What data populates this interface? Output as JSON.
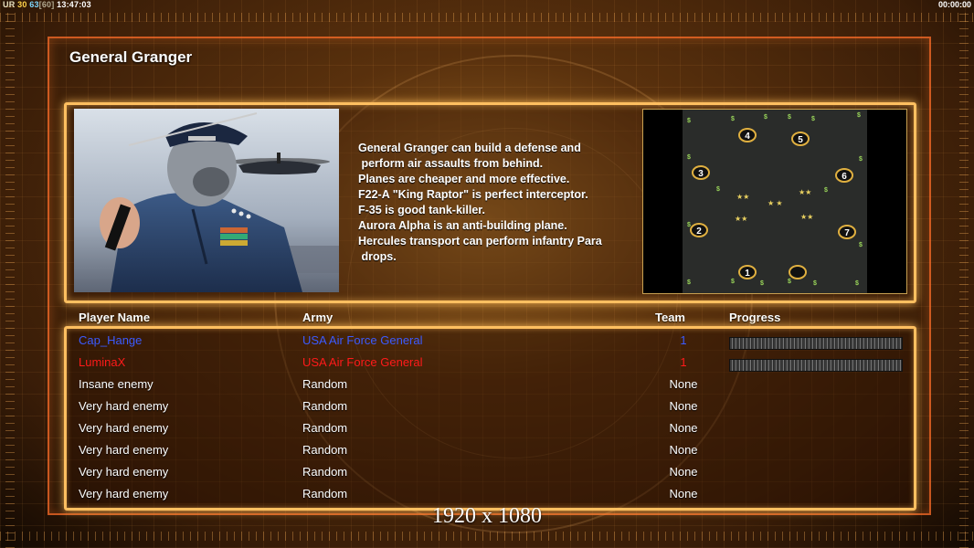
{
  "status_bar": {
    "ur_label": "UR",
    "fps_a": "30",
    "fps_b": "63",
    "fps_c": "[60]",
    "clock": "13:47:03",
    "timer": "00:00:00"
  },
  "title": "General Granger",
  "description_lines": [
    "General Granger can build a defense and",
    " perform air assaults from behind.",
    "Planes are cheaper and more effective.",
    "F22-A \"King Raptor\" is perfect interceptor.",
    "F-35 is good tank-killer.",
    "Aurora Alpha is an anti-building plane.",
    "Hercules transport can perform infantry Para",
    " drops."
  ],
  "minimap": {
    "start_positions": [
      "1",
      "2",
      "3",
      "4",
      "5",
      "6",
      "7",
      ""
    ],
    "resource_symbol": "$"
  },
  "table": {
    "headers": {
      "name": "Player Name",
      "army": "Army",
      "team": "Team",
      "progress": "Progress"
    },
    "rows": [
      {
        "name": "Cap_Hange",
        "army": "USA Air Force General",
        "team": "1",
        "color": "#3b5bff",
        "progress": 0
      },
      {
        "name": "LuminaX",
        "army": "USA Air Force General",
        "team": "1",
        "color": "#ff1a1a",
        "progress": 0
      },
      {
        "name": "Insane enemy",
        "army": "Random",
        "team": "None",
        "color": "#ffffff"
      },
      {
        "name": "Very hard enemy",
        "army": "Random",
        "team": "None",
        "color": "#ffffff"
      },
      {
        "name": "Very hard enemy",
        "army": "Random",
        "team": "None",
        "color": "#ffffff"
      },
      {
        "name": "Very hard enemy",
        "army": "Random",
        "team": "None",
        "color": "#ffffff"
      },
      {
        "name": "Very hard enemy",
        "army": "Random",
        "team": "None",
        "color": "#ffffff"
      },
      {
        "name": "Very hard enemy",
        "army": "Random",
        "team": "None",
        "color": "#ffffff"
      }
    ]
  },
  "resolution_label": "1920 x 1080"
}
